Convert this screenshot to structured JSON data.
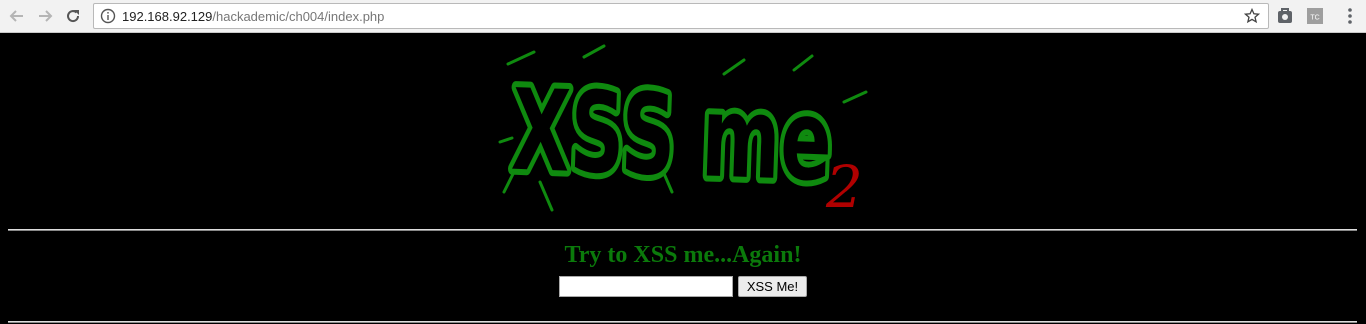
{
  "browser": {
    "back_icon": "arrow-left-icon",
    "forward_icon": "arrow-right-icon",
    "reload_icon": "reload-icon",
    "url_host": "192.168.92.129",
    "url_path": "/hackademic/ch004/index.php",
    "bookmark_icon": "star-icon",
    "extension_icons": [
      "puzzle-extension-icon",
      "tc-extension-icon"
    ],
    "menu_icon": "three-dots-menu-icon"
  },
  "page": {
    "logo_text": "XSS me",
    "logo_subscript": "2",
    "heading": "Try to XSS me...Again!",
    "input_value": "",
    "button_label": "XSS Me!",
    "colors": {
      "background": "#000000",
      "heading": "#0b7a0b",
      "logo_green": "#0f8a0f",
      "logo_red": "#b00000",
      "rule": "#dddddd"
    }
  }
}
